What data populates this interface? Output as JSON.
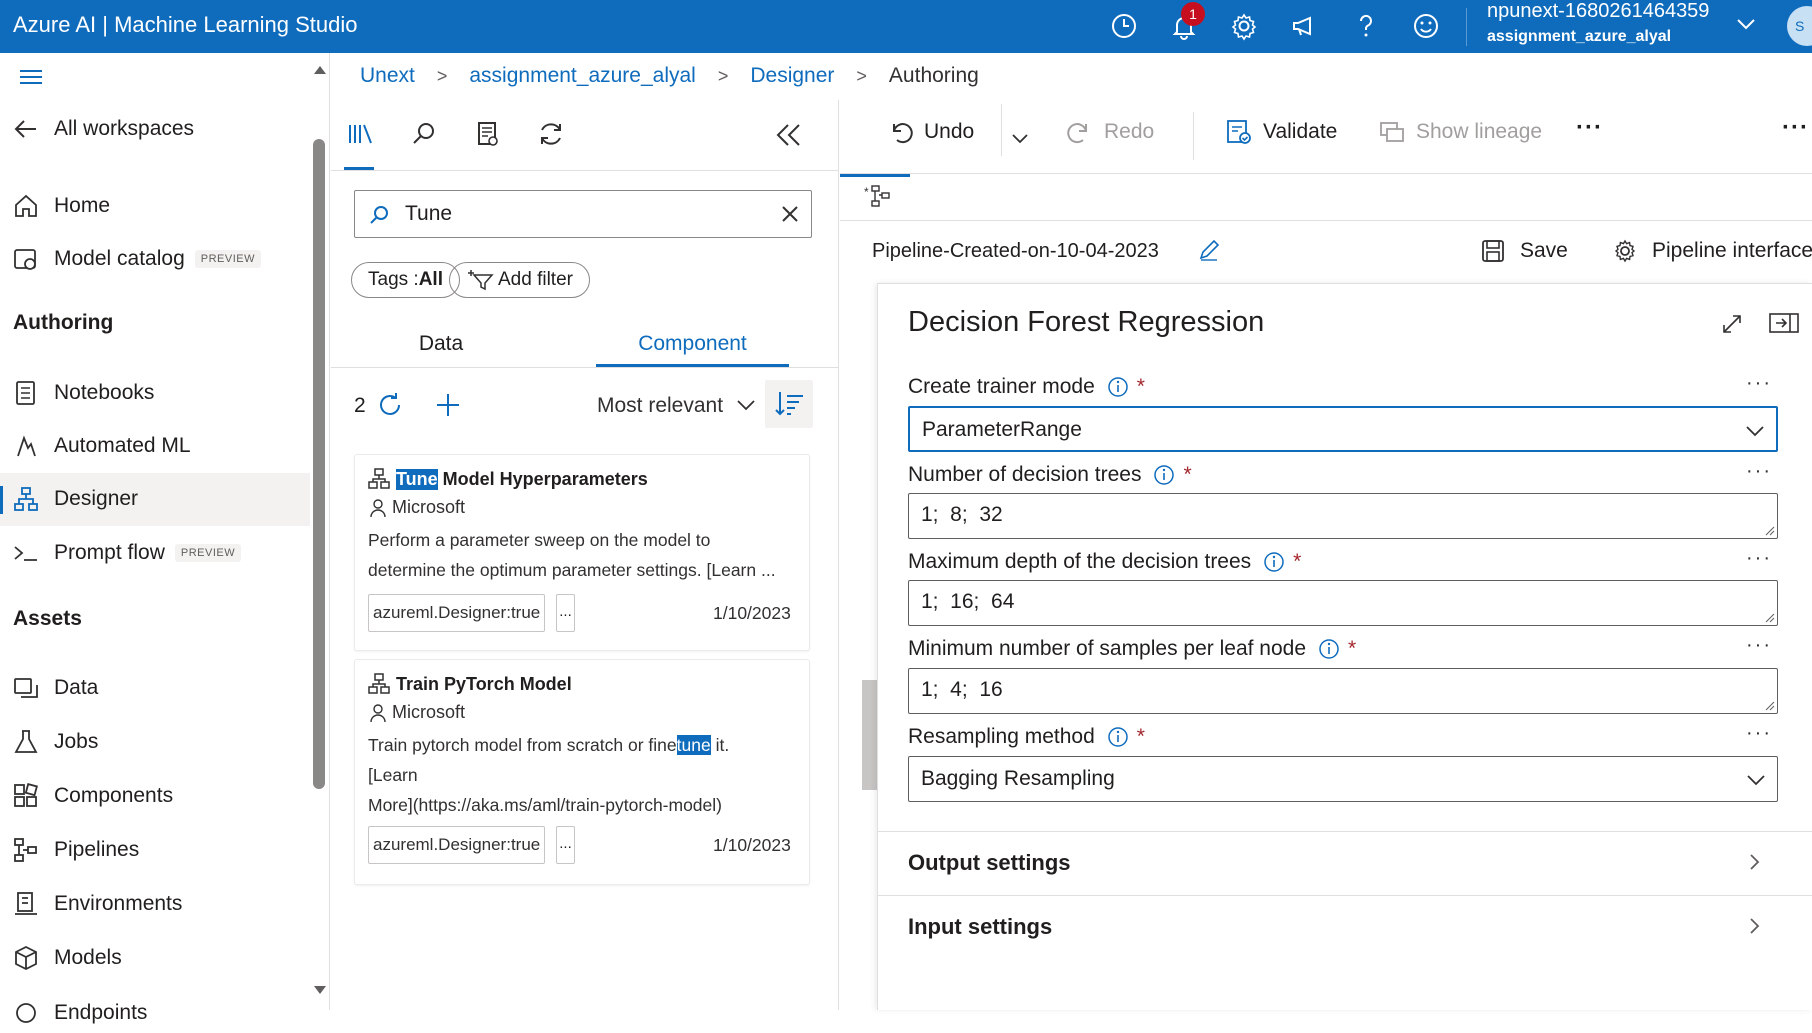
{
  "app": {
    "title": "Azure AI | Machine Learning Studio",
    "notification_count": "1",
    "user_name": "npunext-1680261464359",
    "user_workspace": "assignment_azure_alyal",
    "avatar_initial": "S",
    "brand_color": "#0f6cbd"
  },
  "nav": {
    "all_workspaces": "All workspaces",
    "home": "Home",
    "model_catalog": "Model catalog",
    "preview_badge": "PREVIEW",
    "authoring_header": "Authoring",
    "notebooks": "Notebooks",
    "automated_ml": "Automated ML",
    "designer": "Designer",
    "prompt_flow": "Prompt flow",
    "assets_header": "Assets",
    "data": "Data",
    "jobs": "Jobs",
    "components": "Components",
    "pipelines": "Pipelines",
    "environments": "Environments",
    "models": "Models",
    "endpoints": "Endpoints"
  },
  "breadcrumb": [
    "Unext",
    "assignment_azure_alyal",
    "Designer",
    "Authoring"
  ],
  "library": {
    "search_value": "Tune",
    "tags_label": "Tags : ",
    "tags_value": "All",
    "add_filter": "Add filter",
    "tab_data": "Data",
    "tab_component": "Component",
    "result_count": "2",
    "sort_label": "Most relevant",
    "cards": [
      {
        "title_highlight": "Tune",
        "title_rest": " Model Hyperparameters",
        "author": "Microsoft",
        "desc_line1": "Perform a parameter sweep on the model to",
        "desc_line2": "determine the optimum parameter settings. [Learn ...",
        "tag": "azureml.Designer:true",
        "tag_more": "...",
        "date": "1/10/2023"
      },
      {
        "title": "Train PyTorch Model",
        "author": "Microsoft",
        "desc_pre": "Train pytorch model from scratch or fine",
        "desc_highlight": "tune",
        "desc_post": " it.",
        "desc_line2": "[Learn",
        "desc_line3": "More](https://aka.ms/aml/train-pytorch-model)",
        "tag": "azureml.Designer:true",
        "tag_more": "...",
        "date": "1/10/2023"
      }
    ]
  },
  "toolbar": {
    "undo": "Undo",
    "redo": "Redo",
    "validate": "Validate",
    "show_lineage": "Show lineage",
    "more": "···"
  },
  "canvas": {
    "pipeline_name": "Pipeline-Created-on-10-04-2023",
    "save": "Save",
    "pipeline_interface": "Pipeline interface"
  },
  "properties": {
    "title": "Decision Forest Regression",
    "required_mark": "*",
    "more": "···",
    "create_trainer_mode": {
      "label": "Create trainer mode",
      "value": "ParameterRange"
    },
    "num_trees": {
      "label": "Number of decision trees",
      "value": "1;  8;  32"
    },
    "max_depth": {
      "label": "Maximum depth of the decision trees",
      "value": "1;  16;  64"
    },
    "min_samples": {
      "label": "Minimum number of samples per leaf node",
      "value": "1;  4;  16"
    },
    "resampling": {
      "label": "Resampling method",
      "value": "Bagging Resampling"
    },
    "output_settings": "Output settings",
    "input_settings": "Input settings"
  }
}
